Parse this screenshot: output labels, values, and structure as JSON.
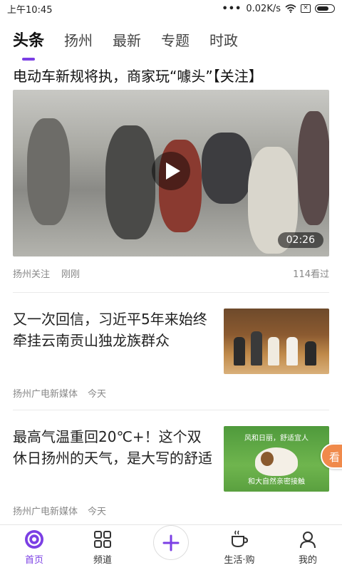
{
  "status": {
    "time": "上午10:45",
    "network": "0.02K/s"
  },
  "tabs": [
    {
      "label": "头条"
    },
    {
      "label": "扬州"
    },
    {
      "label": "最新"
    },
    {
      "label": "专题"
    },
    {
      "label": "时政"
    }
  ],
  "featured": {
    "title": "电动车新规将执，商家玩“噱头”【关注】",
    "duration": "02:26",
    "source": "扬州关注",
    "time": "刚刚",
    "views": "114看过"
  },
  "news": [
    {
      "title": "又一次回信，习近平5年来始终牵挂云南贡山独龙族群众",
      "source": "扬州广电新媒体",
      "time": "今天"
    },
    {
      "title": "最高气温重回20℃+！这个双休日扬州的天气，是大写的舒适",
      "source": "扬州广电新媒体",
      "time": "今天",
      "thumb_caption_top": "风和日丽，舒适宜人",
      "thumb_caption_bottom": "和大自然亲密接触"
    }
  ],
  "side_tab": "看",
  "bottom_nav": [
    {
      "label": "首页",
      "icon": "home-icon"
    },
    {
      "label": "频道",
      "icon": "channels-icon"
    },
    {
      "label": "",
      "icon": "plus-icon"
    },
    {
      "label": "生活·购",
      "icon": "coffee-icon"
    },
    {
      "label": "我的",
      "icon": "user-icon"
    }
  ],
  "colors": {
    "accent": "#7b3fe4",
    "side_tab": "#f08a4b"
  }
}
